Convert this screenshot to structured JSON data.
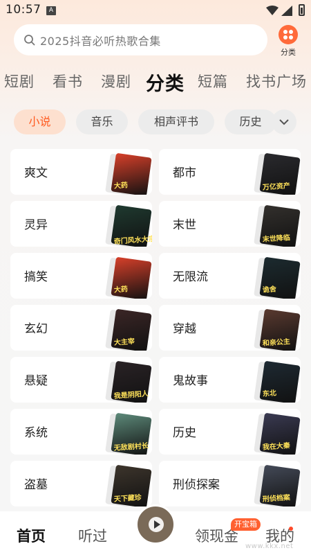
{
  "status_bar": {
    "time": "10:57",
    "a_label": "A"
  },
  "search": {
    "placeholder": "2025抖音必听热歌合集"
  },
  "category_button": {
    "label": "分类"
  },
  "tabs": [
    "短剧",
    "看书",
    "漫剧",
    "分类",
    "短篇",
    "找书广场"
  ],
  "active_tab": "分类",
  "chips": [
    "小说",
    "音乐",
    "相声评书",
    "历史"
  ],
  "active_chip": "小说",
  "genres": [
    {
      "label": "爽文",
      "cover_text": "大药",
      "cover_color": "#d8402a"
    },
    {
      "label": "都市",
      "cover_text": "万亿资产",
      "cover_color": "#2a2a2e"
    },
    {
      "label": "灵异",
      "cover_text": "奇门风水大宗师",
      "cover_color": "#1f3a30"
    },
    {
      "label": "末世",
      "cover_text": "末世降临",
      "cover_color": "#33302d"
    },
    {
      "label": "搞笑",
      "cover_text": "大药",
      "cover_color": "#d8402a"
    },
    {
      "label": "无限流",
      "cover_text": "诡舍",
      "cover_color": "#1c2b30"
    },
    {
      "label": "玄幻",
      "cover_text": "大主宰",
      "cover_color": "#3b2626"
    },
    {
      "label": "穿越",
      "cover_text": "和亲公主",
      "cover_color": "#5a3a30"
    },
    {
      "label": "悬疑",
      "cover_text": "我是阴阳人",
      "cover_color": "#2a2326"
    },
    {
      "label": "鬼故事",
      "cover_text": "东北",
      "cover_color": "#1e2a33"
    },
    {
      "label": "系统",
      "cover_text": "无敌剧村长",
      "cover_color": "#5d8a7a"
    },
    {
      "label": "历史",
      "cover_text": "我在大秦",
      "cover_color": "#3a3a52"
    },
    {
      "label": "盗墓",
      "cover_text": "天下藏珍",
      "cover_color": "#3d352c"
    },
    {
      "label": "刑侦探案",
      "cover_text": "刑侦档案",
      "cover_color": "#444a58"
    }
  ],
  "bottom_nav": {
    "home": "首页",
    "listened": "听过",
    "earn": "领现金",
    "earn_badge": "开宝箱",
    "mine": "我的"
  },
  "watermark": "www.kkx.net"
}
